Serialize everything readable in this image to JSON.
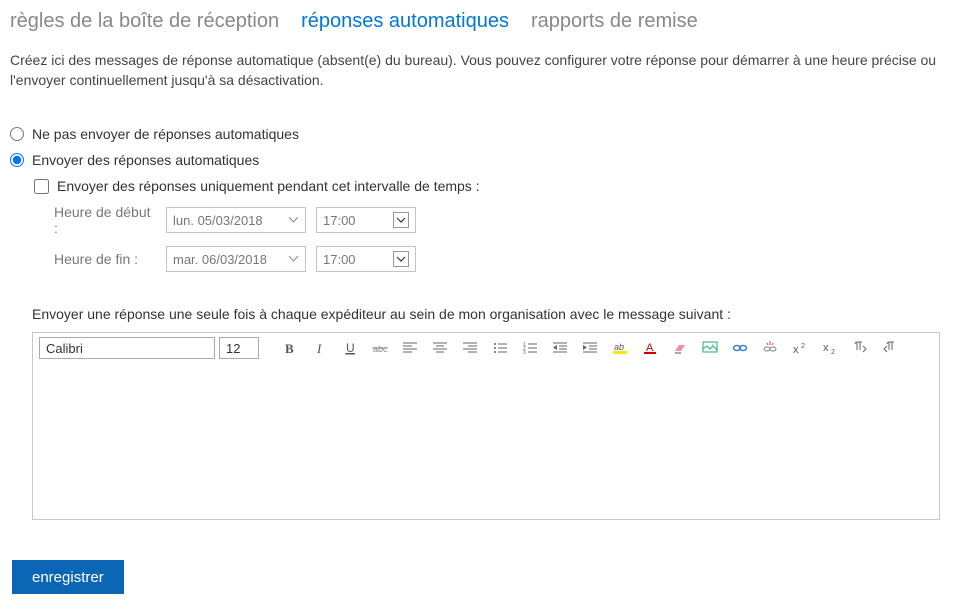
{
  "tabs": {
    "inbox_rules": "règles de la boîte de réception",
    "auto_replies": "réponses automatiques",
    "delivery_reports": "rapports de remise"
  },
  "description": "Créez ici des messages de réponse automatique (absent(e) du bureau). Vous pouvez configurer votre réponse pour démarrer à une heure précise ou l'envoyer continuellement jusqu'à sa désactivation.",
  "radio": {
    "dont_send": "Ne pas envoyer de réponses automatiques",
    "send": "Envoyer des réponses automatiques"
  },
  "interval": {
    "checkbox_label": "Envoyer des réponses uniquement pendant cet intervalle de temps :",
    "start_label": "Heure de début :",
    "start_date": "lun. 05/03/2018",
    "start_time": "17:00",
    "end_label": "Heure de fin :",
    "end_date": "mar. 06/03/2018",
    "end_time": "17:00"
  },
  "message_label": "Envoyer une réponse une seule fois à chaque expéditeur au sein de mon organisation avec le message suivant :",
  "editor": {
    "font": "Calibri",
    "size": "12"
  },
  "buttons": {
    "save": "enregistrer"
  }
}
